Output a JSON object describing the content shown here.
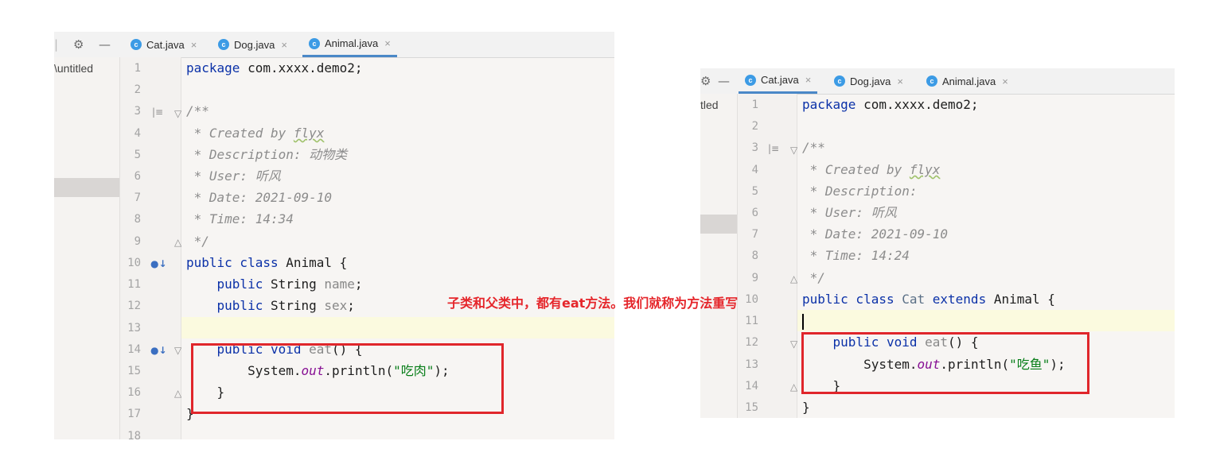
{
  "annotation": "子类和父类中，都有eat方法。我们就称为方法重写",
  "colors": {
    "keyword": "#0b31a8",
    "string": "#067d17",
    "comment": "#8c8c8c",
    "highlight": "#e0262b"
  },
  "icons": {
    "settings": "gear-icon",
    "minimize": "minus-icon",
    "class_file": "java-class-icon",
    "close": "close-icon",
    "override": "override-gutter-icon"
  },
  "left": {
    "project_text": "\\untitled",
    "tabs": [
      {
        "label": "Cat.java",
        "close": "×"
      },
      {
        "label": "Dog.java",
        "close": "×"
      },
      {
        "label": "Animal.java",
        "close": "×"
      }
    ],
    "line_numbers": [
      "1",
      "2",
      "3",
      "4",
      "5",
      "6",
      "7",
      "8",
      "9",
      "10",
      "11",
      "12",
      "13",
      "14",
      "15",
      "16",
      "17",
      "18"
    ],
    "code": {
      "l1_kw": "package",
      "l1_rest": " com.xxxx.demo2;",
      "l3": "/**",
      "l4_a": " * Created by ",
      "l4_b": "flyx",
      "l5": " * Description: 动物类",
      "l6": " * User: 听风",
      "l7": " * Date: 2021-09-10",
      "l8": " * Time: 14:34",
      "l9": " */",
      "l10_kw": "public class",
      "l10_rest": " Animal {",
      "l11_kw": "    public",
      "l11_type": " String ",
      "l11_name": "name",
      "l11_end": ";",
      "l12_kw": "    public",
      "l12_type": " String ",
      "l12_name": "sex",
      "l12_end": ";",
      "l14_kw": "    public void",
      "l14_name": " eat",
      "l14_rest": "() {",
      "l15_a": "        System.",
      "l15_b": "out",
      "l15_c": ".println(",
      "l15_str": "\"吃肉\"",
      "l15_d": ");",
      "l16": "    }",
      "l17": "}"
    }
  },
  "right": {
    "project_text": "tled",
    "tabs": [
      {
        "label": "Cat.java",
        "close": "×"
      },
      {
        "label": "Dog.java",
        "close": "×"
      },
      {
        "label": "Animal.java",
        "close": "×"
      }
    ],
    "line_numbers": [
      "1",
      "2",
      "3",
      "4",
      "5",
      "6",
      "7",
      "8",
      "9",
      "10",
      "11",
      "12",
      "13",
      "14",
      "15"
    ],
    "code": {
      "l1_kw": "package",
      "l1_rest": " com.xxxx.demo2;",
      "l3": "/**",
      "l4_a": " * Created by ",
      "l4_b": "flyx",
      "l5": " * Description:",
      "l6": " * User: 听风",
      "l7": " * Date: 2021-09-10",
      "l8": " * Time: 14:24",
      "l9": " */",
      "l10_kw": "public class",
      "l10_name": " Cat ",
      "l10_kw2": "extends",
      "l10_rest": " Animal {",
      "l12_kw": "    public void",
      "l12_name": " eat",
      "l12_rest": "() {",
      "l13_a": "        System.",
      "l13_b": "out",
      "l13_c": ".println(",
      "l13_str": "\"吃鱼\"",
      "l13_d": ");",
      "l14": "    }",
      "l15": "}"
    }
  }
}
